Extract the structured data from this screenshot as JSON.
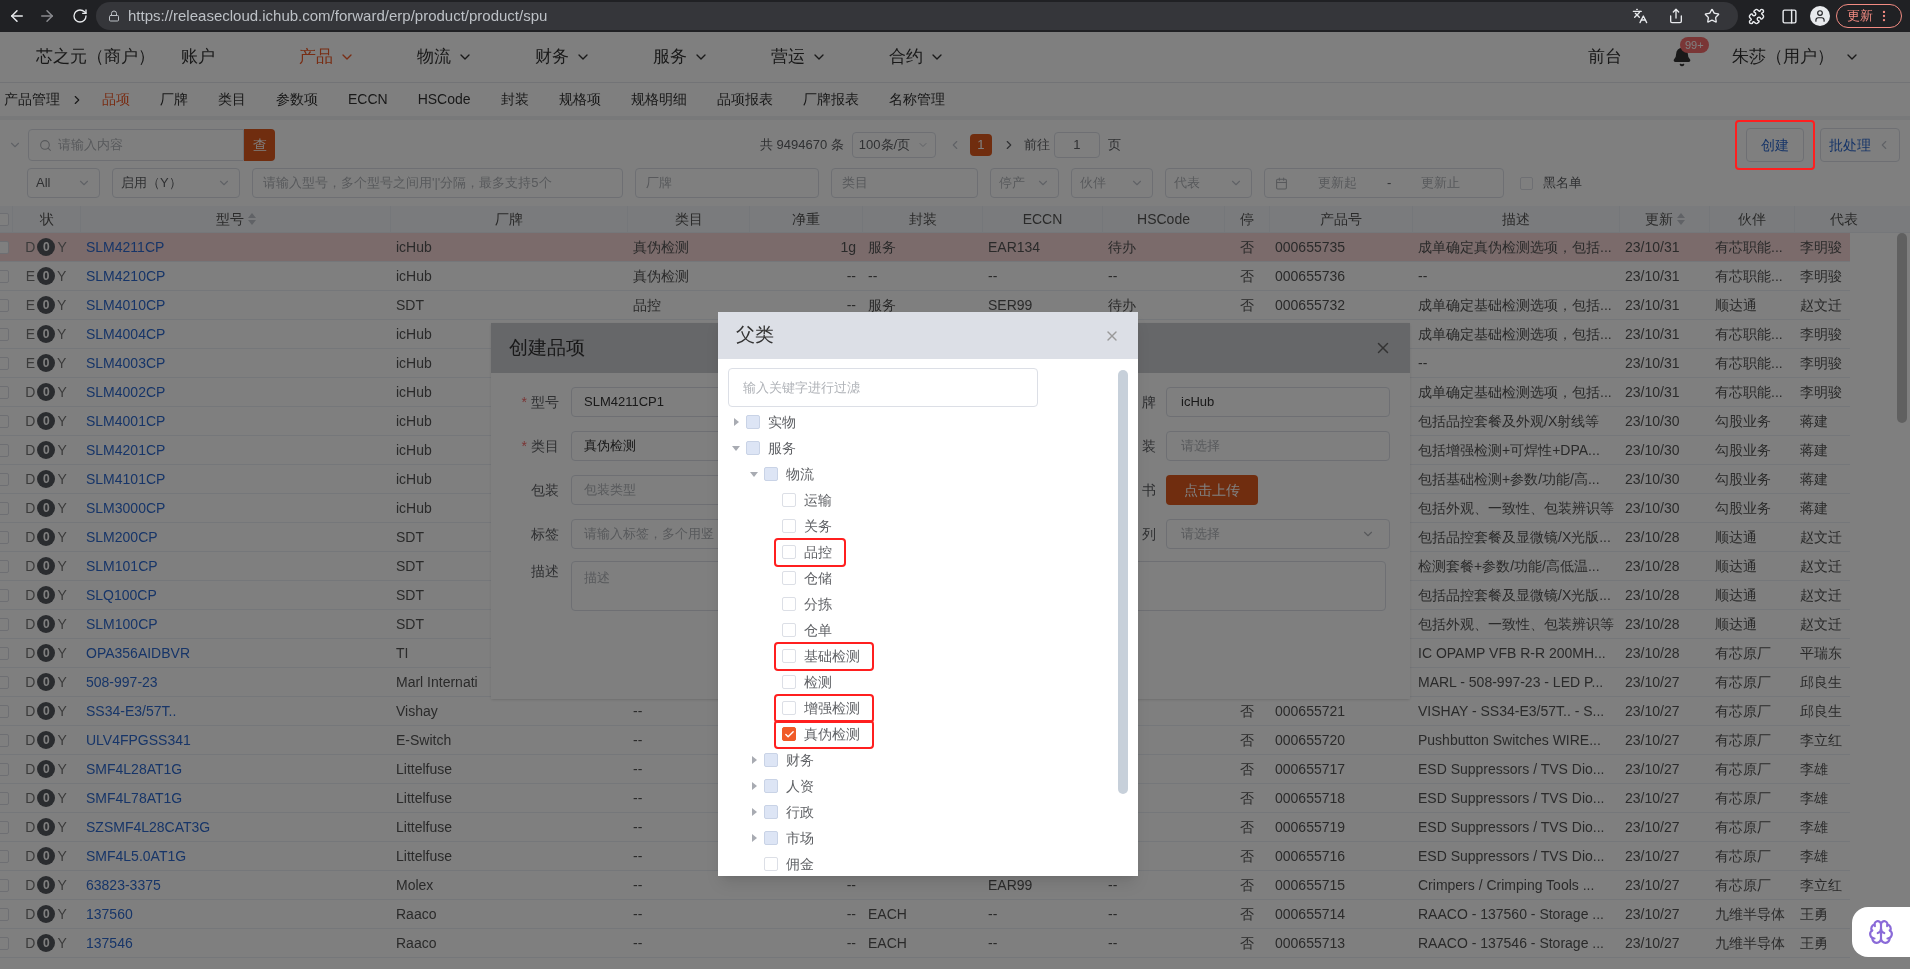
{
  "browser": {
    "url": "https://releasecloud.ichub.com/forward/erp/product/product/spu",
    "update_button": "更新"
  },
  "nav": {
    "brand": "芯之元（商户）",
    "items": [
      {
        "label": "账户",
        "selected": false,
        "dropdown": false
      },
      {
        "label": "产品",
        "selected": true,
        "dropdown": true
      },
      {
        "label": "物流",
        "selected": false,
        "dropdown": true
      },
      {
        "label": "财务",
        "selected": false,
        "dropdown": true
      },
      {
        "label": "服务",
        "selected": false,
        "dropdown": true
      },
      {
        "label": "营运",
        "selected": false,
        "dropdown": true
      },
      {
        "label": "合约",
        "selected": false,
        "dropdown": true
      }
    ],
    "frontdesk": "前台",
    "notifications": "99+",
    "user": "朱莎（用户）"
  },
  "subnav": {
    "root": "产品管理",
    "items": [
      {
        "label": "品项",
        "selected": true
      },
      {
        "label": "厂牌",
        "selected": false
      },
      {
        "label": "类目",
        "selected": false
      },
      {
        "label": "参数项",
        "selected": false
      },
      {
        "label": "ECCN",
        "selected": false
      },
      {
        "label": "HSCode",
        "selected": false
      },
      {
        "label": "封装",
        "selected": false
      },
      {
        "label": "规格项",
        "selected": false
      },
      {
        "label": "规格明细",
        "selected": false
      },
      {
        "label": "品项报表",
        "selected": false
      },
      {
        "label": "厂牌报表",
        "selected": false
      },
      {
        "label": "名称管理",
        "selected": false
      }
    ]
  },
  "toolbar": {
    "search_placeholder": "请输入内容",
    "search_button": "查",
    "total": "共 9494670 条",
    "page_size": "100条/页",
    "pages": [
      {
        "label": "1",
        "selected": true
      }
    ],
    "goto_label": "前往",
    "goto_value": "1",
    "page_unit": "页",
    "create_button": {
      "label": "创建",
      "annotated": true
    },
    "batch_button": "批处理"
  },
  "filters": {
    "scope": "All",
    "enabled": "启用（Y）",
    "model_placeholder": "请输入型号，多个型号之间用'|'分隔，最多支持5个",
    "brand_placeholder": "厂牌",
    "category_placeholder": "类目",
    "discontinued_placeholder": "停产",
    "partner_placeholder": "伙伴",
    "rep_placeholder": "代表",
    "date_from_placeholder": "更新起",
    "date_separator": "-",
    "date_to_placeholder": "更新止",
    "blacklist": {
      "label": "黑名单",
      "checked": false
    }
  },
  "table": {
    "all_checked": false,
    "columns": [
      {
        "label": "状",
        "sortable": false
      },
      {
        "label": "型号",
        "sortable": true
      },
      {
        "label": "厂牌",
        "sortable": false
      },
      {
        "label": "类目",
        "sortable": false
      },
      {
        "label": "净重",
        "sortable": false
      },
      {
        "label": "封装",
        "sortable": false
      },
      {
        "label": "ECCN",
        "sortable": false
      },
      {
        "label": "HSCode",
        "sortable": false
      },
      {
        "label": "停",
        "sortable": false
      },
      {
        "label": "产品号",
        "sortable": false
      },
      {
        "label": "描述",
        "sortable": false
      },
      {
        "label": "更新",
        "sortable": true
      },
      {
        "label": "伙伴",
        "sortable": false
      },
      {
        "label": "代表",
        "sortable": false
      }
    ],
    "rows": [
      {
        "selected": true,
        "checked": false,
        "state": "D",
        "count": "0",
        "flag": "Y",
        "model": "SLM4211CP",
        "brand": "icHub",
        "category": "真伪检测",
        "weight": "1g",
        "package": "服务",
        "eccn": "EAR134",
        "hscode": "待办",
        "stop": "否",
        "product_no": "000655735",
        "description": "成单确定真伪检测选项，包括...",
        "updated": "23/10/31",
        "partner": "有芯职能...",
        "rep": "李明骏"
      },
      {
        "selected": false,
        "checked": false,
        "state": "E",
        "count": "0",
        "flag": "Y",
        "model": "SLM4210CP",
        "brand": "icHub",
        "category": "真伪检测",
        "weight": "--",
        "package": "--",
        "eccn": "--",
        "hscode": "--",
        "stop": "否",
        "product_no": "000655736",
        "description": "--",
        "updated": "23/10/31",
        "partner": "有芯职能...",
        "rep": "李明骏"
      },
      {
        "selected": false,
        "checked": false,
        "state": "E",
        "count": "0",
        "flag": "Y",
        "model": "SLM4010CP",
        "brand": "SDT",
        "category": "品控",
        "weight": "--",
        "package": "服务",
        "eccn": "SER99",
        "hscode": "待办",
        "stop": "否",
        "product_no": "000655732",
        "description": "成单确定基础检测选项，包括...",
        "updated": "23/10/31",
        "partner": "顺达通",
        "rep": "赵文迁"
      },
      {
        "selected": false,
        "checked": false,
        "state": "E",
        "count": "0",
        "flag": "Y",
        "model": "SLM4004CP",
        "brand": "icHub",
        "description": "成单确定基础检测选项，包括...",
        "updated": "23/10/31",
        "partner": "有芯职能...",
        "rep": "李明骏"
      },
      {
        "selected": false,
        "checked": false,
        "state": "E",
        "count": "0",
        "flag": "Y",
        "model": "SLM4003CP",
        "brand": "icHub",
        "description": "--",
        "updated": "23/10/31",
        "partner": "有芯职能...",
        "rep": "李明骏"
      },
      {
        "selected": false,
        "checked": false,
        "state": "D",
        "count": "0",
        "flag": "Y",
        "model": "SLM4002CP",
        "brand": "icHub",
        "description": "成单确定基础检测选项，包括...",
        "updated": "23/10/31",
        "partner": "有芯职能...",
        "rep": "李明骏"
      },
      {
        "selected": false,
        "checked": false,
        "state": "D",
        "count": "0",
        "flag": "Y",
        "model": "SLM4001CP",
        "brand": "icHub",
        "description": "包括品控套餐及外观/X射线等",
        "updated": "23/10/30",
        "partner": "勾股业务",
        "rep": "蒋建"
      },
      {
        "selected": false,
        "checked": false,
        "state": "D",
        "count": "0",
        "flag": "Y",
        "model": "SLM4201CP",
        "brand": "icHub",
        "description": "包括增强检测+可焊性+DPA...",
        "updated": "23/10/30",
        "partner": "勾股业务",
        "rep": "蒋建"
      },
      {
        "selected": false,
        "checked": false,
        "state": "D",
        "count": "0",
        "flag": "Y",
        "model": "SLM4101CP",
        "brand": "icHub",
        "description": "包括基础检测+参数/功能/高...",
        "updated": "23/10/30",
        "partner": "勾股业务",
        "rep": "蒋建"
      },
      {
        "selected": false,
        "checked": false,
        "state": "D",
        "count": "0",
        "flag": "Y",
        "model": "SLM3000CP",
        "brand": "icHub",
        "description": "包括外观、一致性、包装辨识等",
        "updated": "23/10/30",
        "partner": "勾股业务",
        "rep": "蒋建"
      },
      {
        "selected": false,
        "checked": false,
        "state": "D",
        "count": "0",
        "flag": "Y",
        "model": "SLM200CP",
        "brand": "SDT",
        "description": "包括品控套餐及显微镜/X光版...",
        "updated": "23/10/28",
        "partner": "顺达通",
        "rep": "赵文迁"
      },
      {
        "selected": false,
        "checked": false,
        "state": "D",
        "count": "0",
        "flag": "Y",
        "model": "SLM101CP",
        "brand": "SDT",
        "description": "检测套餐+参数/功能/高低温...",
        "updated": "23/10/28",
        "partner": "顺达通",
        "rep": "赵文迁"
      },
      {
        "selected": false,
        "checked": false,
        "state": "D",
        "count": "0",
        "flag": "Y",
        "model": "SLQ100CP",
        "brand": "SDT",
        "description": "包括品控套餐及显微镜/X光版...",
        "updated": "23/10/28",
        "partner": "顺达通",
        "rep": "赵文迁"
      },
      {
        "selected": false,
        "checked": false,
        "state": "D",
        "count": "0",
        "flag": "Y",
        "model": "SLM100CP",
        "brand": "SDT",
        "description": "包括外观、一致性、包装辨识等",
        "updated": "23/10/28",
        "partner": "顺达通",
        "rep": "赵文迁"
      },
      {
        "selected": false,
        "checked": false,
        "state": "D",
        "count": "0",
        "flag": "Y",
        "model": "OPA356AIDBVR",
        "brand": "TI",
        "description": "IC OPAMP VFB R-R 200MH...",
        "updated": "23/10/28",
        "partner": "有芯原厂",
        "rep": "平瑞东"
      },
      {
        "selected": false,
        "checked": false,
        "state": "D",
        "count": "0",
        "flag": "Y",
        "model": "508-997-23",
        "brand": "Marl Internati",
        "description": "MARL - 508-997-23 - LED P...",
        "updated": "23/10/27",
        "partner": "有芯原厂",
        "rep": "邱良生"
      },
      {
        "selected": false,
        "checked": false,
        "state": "D",
        "count": "0",
        "flag": "Y",
        "model": "SS34-E3/57T..",
        "brand": "Vishay",
        "category": "--",
        "stop": "否",
        "product_no": "000655721",
        "description": "VISHAY - SS34-E3/57T.. - S...",
        "updated": "23/10/27",
        "partner": "有芯原厂",
        "rep": "邱良生"
      },
      {
        "selected": false,
        "checked": false,
        "state": "D",
        "count": "0",
        "flag": "Y",
        "model": "ULV4FPGSS341",
        "brand": "E-Switch",
        "category": "--",
        "stop": "否",
        "product_no": "000655720",
        "description": "Pushbutton Switches WIRE...",
        "updated": "23/10/27",
        "partner": "有芯原厂",
        "rep": "李立红"
      },
      {
        "selected": false,
        "checked": false,
        "state": "D",
        "count": "0",
        "flag": "Y",
        "model": "SMF4L28AT1G",
        "brand": "Littelfuse",
        "category": "--",
        "stop": "否",
        "product_no": "000655717",
        "description": "ESD Suppressors / TVS Dio...",
        "updated": "23/10/27",
        "partner": "有芯原厂",
        "rep": "李雄"
      },
      {
        "selected": false,
        "checked": false,
        "state": "D",
        "count": "0",
        "flag": "Y",
        "model": "SMF4L78AT1G",
        "brand": "Littelfuse",
        "category": "--",
        "stop": "否",
        "product_no": "000655718",
        "description": "ESD Suppressors / TVS Dio...",
        "updated": "23/10/27",
        "partner": "有芯原厂",
        "rep": "李雄"
      },
      {
        "selected": false,
        "checked": false,
        "state": "D",
        "count": "0",
        "flag": "Y",
        "model": "SZSMF4L28CAT3G",
        "brand": "Littelfuse",
        "category": "--",
        "stop": "否",
        "product_no": "000655719",
        "description": "ESD Suppressors / TVS Dio...",
        "updated": "23/10/27",
        "partner": "有芯原厂",
        "rep": "李雄"
      },
      {
        "selected": false,
        "checked": false,
        "state": "D",
        "count": "0",
        "flag": "Y",
        "model": "SMF4L5.0AT1G",
        "brand": "Littelfuse",
        "category": "--",
        "stop": "否",
        "product_no": "000655716",
        "description": "ESD Suppressors / TVS Dio...",
        "updated": "23/10/27",
        "partner": "有芯原厂",
        "rep": "李雄"
      },
      {
        "selected": false,
        "checked": false,
        "state": "D",
        "count": "0",
        "flag": "Y",
        "model": "63823-3375",
        "brand": "Molex",
        "category": "--",
        "weight": "--",
        "eccn": "EAR99",
        "hscode": "--",
        "stop": "否",
        "product_no": "000655715",
        "description": "Crimpers / Crimping Tools ...",
        "updated": "23/10/27",
        "partner": "有芯原厂",
        "rep": "李立红"
      },
      {
        "selected": false,
        "checked": false,
        "state": "D",
        "count": "0",
        "flag": "Y",
        "model": "137560",
        "brand": "Raaco",
        "category": "--",
        "weight": "--",
        "package": "EACH",
        "eccn": "--",
        "hscode": "--",
        "stop": "否",
        "product_no": "000655714",
        "description": "RAACO - 137560 - Storage ...",
        "updated": "23/10/27",
        "partner": "九维半导体",
        "rep": "王勇"
      },
      {
        "selected": false,
        "checked": false,
        "state": "D",
        "count": "0",
        "flag": "Y",
        "model": "137546",
        "brand": "Raaco",
        "category": "--",
        "weight": "--",
        "package": "EACH",
        "eccn": "--",
        "hscode": "--",
        "stop": "否",
        "product_no": "000655713",
        "description": "RAACO - 137546 - Storage ...",
        "updated": "23/10/27",
        "partner": "九维半导体",
        "rep": "王勇"
      }
    ]
  },
  "create_dialog": {
    "title": "创建品项",
    "left_fields": [
      {
        "marker": "*",
        "label": "型号",
        "value": "SLM4211CP1"
      },
      {
        "marker": "*",
        "label": "类目",
        "value": "真伪检测"
      },
      {
        "label": "包装",
        "placeholder": "包装类型"
      },
      {
        "label": "标签",
        "placeholder": "请输入标签，多个用竖"
      }
    ],
    "right_fields": [
      {
        "kind": "input",
        "label": "牌",
        "value": "icHub"
      },
      {
        "kind": "input",
        "label": "装",
        "placeholder": "请选择"
      },
      {
        "kind": "upload",
        "label": "书",
        "button": "点击上传"
      },
      {
        "kind": "select",
        "label": "列",
        "placeholder": "请选择"
      }
    ],
    "description": {
      "label": "描述",
      "placeholder": "描述"
    }
  },
  "parent_dialog": {
    "title": "父类",
    "filter_placeholder": "输入关键字进行过滤",
    "tree": [
      {
        "label": "实物",
        "expandable": true,
        "expanded": false,
        "checked": false,
        "disabled": true,
        "annotated": false
      },
      {
        "label": "服务",
        "expandable": true,
        "expanded": true,
        "checked": false,
        "disabled": true,
        "annotated": false,
        "children": [
          {
            "label": "物流",
            "expandable": true,
            "expanded": true,
            "checked": false,
            "disabled": true,
            "annotated": false,
            "children": [
              {
                "label": "运输",
                "expandable": false,
                "checked": false,
                "disabled": false,
                "annotated": false
              },
              {
                "label": "关务",
                "expandable": false,
                "checked": false,
                "disabled": false,
                "annotated": false
              },
              {
                "label": "品控",
                "expandable": false,
                "checked": false,
                "disabled": false,
                "annotated": true
              },
              {
                "label": "仓储",
                "expandable": false,
                "checked": false,
                "disabled": false,
                "annotated": false
              },
              {
                "label": "分拣",
                "expandable": false,
                "checked": false,
                "disabled": false,
                "annotated": false
              },
              {
                "label": "仓单",
                "expandable": false,
                "checked": false,
                "disabled": false,
                "annotated": false
              },
              {
                "label": "基础检测",
                "expandable": false,
                "checked": false,
                "disabled": false,
                "annotated": true
              },
              {
                "label": "检测",
                "expandable": false,
                "checked": false,
                "disabled": false,
                "annotated": false
              },
              {
                "label": "增强检测",
                "expandable": false,
                "checked": false,
                "disabled": false,
                "annotated": true
              },
              {
                "label": "真伪检测",
                "expandable": false,
                "checked": true,
                "disabled": false,
                "annotated": true
              }
            ]
          },
          {
            "label": "财务",
            "expandable": true,
            "expanded": false,
            "checked": false,
            "disabled": true,
            "annotated": false
          },
          {
            "label": "人资",
            "expandable": true,
            "expanded": false,
            "checked": false,
            "disabled": true,
            "annotated": false
          },
          {
            "label": "行政",
            "expandable": true,
            "expanded": false,
            "checked": false,
            "disabled": true,
            "annotated": false
          },
          {
            "label": "市场",
            "expandable": true,
            "expanded": false,
            "checked": false,
            "disabled": true,
            "annotated": false
          },
          {
            "label": "佣金",
            "expandable": false,
            "checked": false,
            "disabled": false,
            "annotated": false
          }
        ]
      }
    ]
  }
}
